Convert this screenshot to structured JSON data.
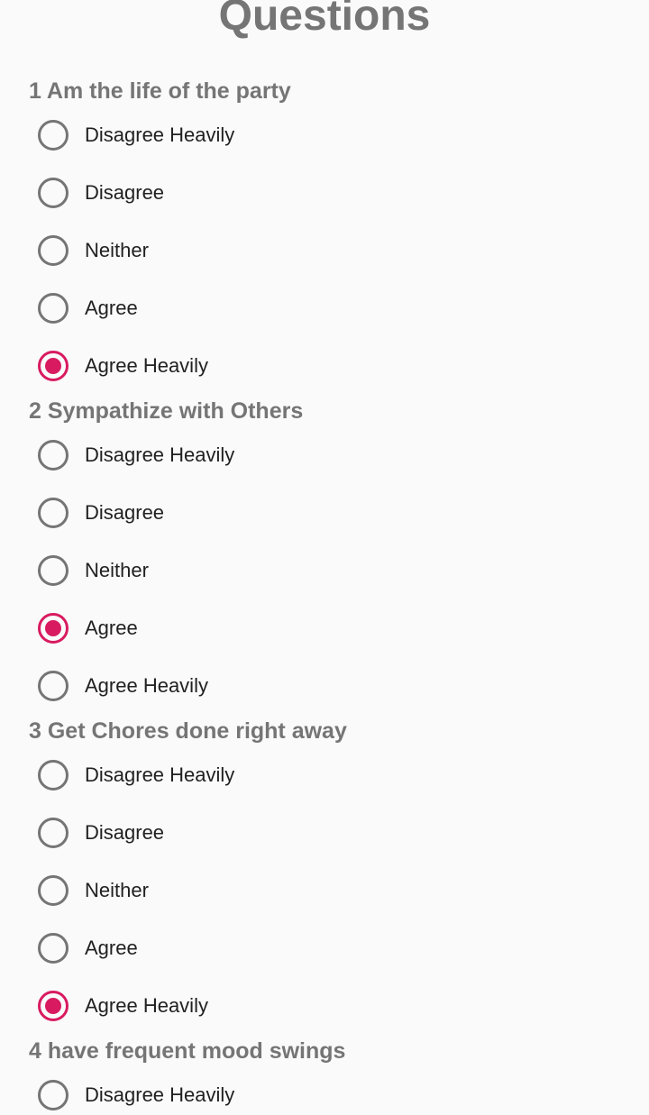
{
  "header": {
    "title": "Questions"
  },
  "colors": {
    "accent": "#d81b60",
    "title": "#757575",
    "radio_unchecked": "#757575",
    "text": "#212121"
  },
  "questions": [
    {
      "title": "1 Am the life of the party",
      "options": [
        {
          "label": "Disagree Heavily",
          "checked": false
        },
        {
          "label": "Disagree",
          "checked": false
        },
        {
          "label": "Neither",
          "checked": false
        },
        {
          "label": "Agree",
          "checked": false
        },
        {
          "label": "Agree Heavily",
          "checked": true
        }
      ]
    },
    {
      "title": "2 Sympathize with Others",
      "options": [
        {
          "label": "Disagree Heavily",
          "checked": false
        },
        {
          "label": "Disagree",
          "checked": false
        },
        {
          "label": "Neither",
          "checked": false
        },
        {
          "label": "Agree",
          "checked": true
        },
        {
          "label": "Agree Heavily",
          "checked": false
        }
      ]
    },
    {
      "title": "3 Get Chores done right away",
      "options": [
        {
          "label": "Disagree Heavily",
          "checked": false
        },
        {
          "label": "Disagree",
          "checked": false
        },
        {
          "label": "Neither",
          "checked": false
        },
        {
          "label": "Agree",
          "checked": false
        },
        {
          "label": "Agree Heavily",
          "checked": true
        }
      ]
    },
    {
      "title": "4 have frequent mood swings",
      "options": [
        {
          "label": "Disagree Heavily",
          "checked": false
        }
      ]
    }
  ]
}
